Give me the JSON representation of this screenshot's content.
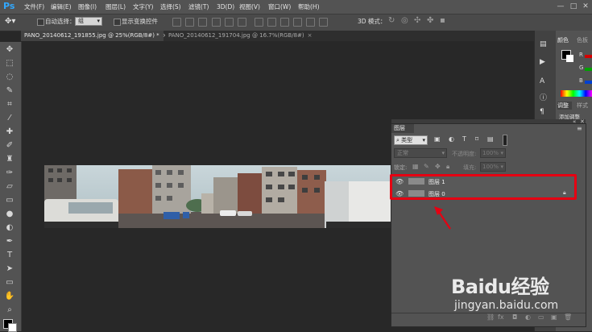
{
  "app": {
    "logo": "Ps"
  },
  "menu": [
    "文件(F)",
    "编辑(E)",
    "图像(I)",
    "图层(L)",
    "文字(Y)",
    "选择(S)",
    "滤镜(T)",
    "3D(D)",
    "视图(V)",
    "窗口(W)",
    "帮助(H)"
  ],
  "window_controls": [
    "—",
    "□",
    "✕"
  ],
  "options": {
    "auto_select_label": "自动选择：",
    "auto_select_value": "组",
    "show_transform_label": "显示变换控件",
    "mode_3d_label": "3D 模式："
  },
  "tabs": [
    {
      "label": "PANO_20140612_191855.jpg @ 25%(RGB/8#) *"
    },
    {
      "label": "PANO_20140612_191704.jpg @ 16.7%(RGB/8#)"
    }
  ],
  "right_panels": {
    "color_tab": "颜色",
    "swatch_tab": "色板",
    "r": "R",
    "g": "G",
    "b": "B",
    "adjust_tab": "调整",
    "style_tab": "样式",
    "add_adjust": "添加调整"
  },
  "layers_panel": {
    "title": "图层",
    "filter_label": "类型",
    "blend_mode": "正常",
    "opacity_label": "不透明度:",
    "opacity_value": "100%",
    "lock_label": "锁定:",
    "fill_label": "填充:",
    "fill_value": "100%",
    "layers": [
      {
        "name": "图层 1",
        "locked": false
      },
      {
        "name": "图层 0",
        "locked": true
      }
    ]
  },
  "watermark": {
    "brand": "Baidu经验",
    "url": "jingyan.baidu.com"
  },
  "colors": {
    "accent_red": "#e60012",
    "ps_blue": "#31a8ff"
  }
}
